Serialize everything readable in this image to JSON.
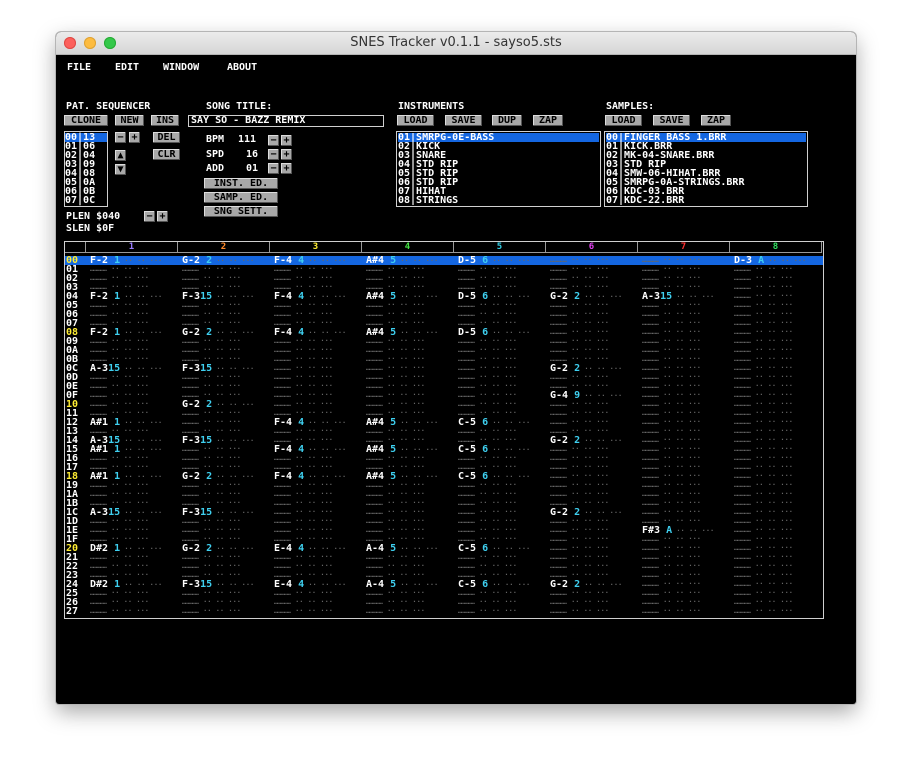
{
  "window": {
    "title": "SNES Tracker v0.1.1 - sayso5.sts"
  },
  "menu": [
    "FILE",
    "EDIT",
    "WINDOW",
    "ABOUT"
  ],
  "pattern_sequencer": {
    "heading": "PAT. SEQUENCER",
    "buttons": [
      "CLONE",
      "NEW",
      "INS",
      "DEL",
      "CLR"
    ],
    "entries": [
      "00|13",
      "01|06",
      "02|04",
      "03|09",
      "04|08",
      "05|0A",
      "06|0B",
      "07|0C"
    ],
    "selected": 0,
    "plen_label": "PLEN $040",
    "slen_label": "SLEN $0F"
  },
  "song": {
    "heading": "SONG TITLE:",
    "title": "SAY SO - BAZZ REMIX",
    "bpm_label": "BPM",
    "bpm": "111",
    "spd_label": "SPD",
    "spd": "16",
    "add_label": "ADD",
    "add": "01",
    "editor_buttons": [
      "INST. ED.",
      "SAMP. ED.",
      "SNG SETT."
    ]
  },
  "instruments": {
    "heading": "INSTRUMENTS",
    "buttons": [
      "LOAD",
      "SAVE",
      "DUP",
      "ZAP"
    ],
    "items": [
      "01|SMRPG-0E-BASS",
      "02|KICK",
      "03|SNARE",
      "04|STD RIP",
      "05|STD RIP",
      "06|STD RIP",
      "07|HIHAT",
      "08|STRINGS"
    ],
    "selected": 0
  },
  "samples": {
    "heading": "SAMPLES:",
    "buttons": [
      "LOAD",
      "SAVE",
      "ZAP"
    ],
    "items": [
      "00|FINGER BASS 1.BRR",
      "01|KICK.BRR",
      "02|MK-04-SNARE.BRR",
      "03|STD RIP",
      "04|SMW-06-HIHAT.BRR",
      "05|SMRPG-0A-STRINGS.BRR",
      "06|KDC-03.BRR",
      "07|KDC-22.BRR"
    ],
    "selected": 0
  },
  "tracker": {
    "channels": [
      {
        "label": "1",
        "color": "#9b7dff"
      },
      {
        "label": "2",
        "color": "#ff8a2a"
      },
      {
        "label": "3",
        "color": "#ffee33"
      },
      {
        "label": "4",
        "color": "#44e044"
      },
      {
        "label": "5",
        "color": "#33d0e8"
      },
      {
        "label": "6",
        "color": "#e040f0"
      },
      {
        "label": "7",
        "color": "#ff3030"
      },
      {
        "label": "8",
        "color": "#30e060"
      }
    ],
    "rows": [
      "00",
      "01",
      "02",
      "03",
      "04",
      "05",
      "06",
      "07",
      "08",
      "09",
      "0A",
      "0B",
      "0C",
      "0D",
      "0E",
      "0F",
      "10",
      "11",
      "12",
      "13",
      "14",
      "15",
      "16",
      "17",
      "18",
      "19",
      "1A",
      "1B",
      "1C",
      "1D",
      "1E",
      "1F",
      "20",
      "21",
      "22",
      "23",
      "24",
      "25",
      "26",
      "27"
    ],
    "highlight_row_color": "#ffee33",
    "selected_row": 0,
    "notes": [
      {
        "row": 0,
        "ch": 0,
        "note": "F-2",
        "ins": "1"
      },
      {
        "row": 0,
        "ch": 1,
        "note": "G-2",
        "ins": "2"
      },
      {
        "row": 0,
        "ch": 2,
        "note": "F-4",
        "ins": "4"
      },
      {
        "row": 0,
        "ch": 3,
        "note": "A#4",
        "ins": "5"
      },
      {
        "row": 0,
        "ch": 4,
        "note": "D-5",
        "ins": "6"
      },
      {
        "row": 0,
        "ch": 7,
        "note": "D-3",
        "ins": "A"
      },
      {
        "row": 4,
        "ch": 0,
        "note": "F-2",
        "ins": "1"
      },
      {
        "row": 4,
        "ch": 1,
        "note": "F-3",
        "ins": "15"
      },
      {
        "row": 4,
        "ch": 2,
        "note": "F-4",
        "ins": "4"
      },
      {
        "row": 4,
        "ch": 3,
        "note": "A#4",
        "ins": "5"
      },
      {
        "row": 4,
        "ch": 4,
        "note": "D-5",
        "ins": "6"
      },
      {
        "row": 4,
        "ch": 5,
        "note": "G-2",
        "ins": "2"
      },
      {
        "row": 4,
        "ch": 6,
        "note": "A-3",
        "ins": "15"
      },
      {
        "row": 8,
        "ch": 0,
        "note": "F-2",
        "ins": "1"
      },
      {
        "row": 8,
        "ch": 1,
        "note": "G-2",
        "ins": "2"
      },
      {
        "row": 8,
        "ch": 2,
        "note": "F-4",
        "ins": "4"
      },
      {
        "row": 8,
        "ch": 3,
        "note": "A#4",
        "ins": "5"
      },
      {
        "row": 8,
        "ch": 4,
        "note": "D-5",
        "ins": "6"
      },
      {
        "row": 12,
        "ch": 0,
        "note": "A-3",
        "ins": "15"
      },
      {
        "row": 12,
        "ch": 1,
        "note": "F-3",
        "ins": "15"
      },
      {
        "row": 12,
        "ch": 5,
        "note": "G-2",
        "ins": "2"
      },
      {
        "row": 15,
        "ch": 5,
        "note": "G-4",
        "ins": "9"
      },
      {
        "row": 16,
        "ch": 1,
        "note": "G-2",
        "ins": "2"
      },
      {
        "row": 18,
        "ch": 0,
        "note": "A#1",
        "ins": "1"
      },
      {
        "row": 18,
        "ch": 2,
        "note": "F-4",
        "ins": "4"
      },
      {
        "row": 18,
        "ch": 3,
        "note": "A#4",
        "ins": "5"
      },
      {
        "row": 18,
        "ch": 4,
        "note": "C-5",
        "ins": "6"
      },
      {
        "row": 20,
        "ch": 0,
        "note": "A-3",
        "ins": "15"
      },
      {
        "row": 20,
        "ch": 1,
        "note": "F-3",
        "ins": "15"
      },
      {
        "row": 20,
        "ch": 5,
        "note": "G-2",
        "ins": "2"
      },
      {
        "row": 21,
        "ch": 0,
        "note": "A#1",
        "ins": "1"
      },
      {
        "row": 21,
        "ch": 2,
        "note": "F-4",
        "ins": "4"
      },
      {
        "row": 21,
        "ch": 3,
        "note": "A#4",
        "ins": "5"
      },
      {
        "row": 21,
        "ch": 4,
        "note": "C-5",
        "ins": "6"
      },
      {
        "row": 24,
        "ch": 0,
        "note": "A#1",
        "ins": "1"
      },
      {
        "row": 24,
        "ch": 1,
        "note": "G-2",
        "ins": "2"
      },
      {
        "row": 24,
        "ch": 2,
        "note": "F-4",
        "ins": "4"
      },
      {
        "row": 24,
        "ch": 3,
        "note": "A#4",
        "ins": "5"
      },
      {
        "row": 24,
        "ch": 4,
        "note": "C-5",
        "ins": "6"
      },
      {
        "row": 28,
        "ch": 0,
        "note": "A-3",
        "ins": "15"
      },
      {
        "row": 28,
        "ch": 1,
        "note": "F-3",
        "ins": "15"
      },
      {
        "row": 28,
        "ch": 5,
        "note": "G-2",
        "ins": "2"
      },
      {
        "row": 30,
        "ch": 6,
        "note": "F#3",
        "ins": "A"
      },
      {
        "row": 32,
        "ch": 0,
        "note": "D#2",
        "ins": "1"
      },
      {
        "row": 32,
        "ch": 1,
        "note": "G-2",
        "ins": "2"
      },
      {
        "row": 32,
        "ch": 2,
        "note": "E-4",
        "ins": "4"
      },
      {
        "row": 32,
        "ch": 3,
        "note": "A-4",
        "ins": "5"
      },
      {
        "row": 32,
        "ch": 4,
        "note": "C-5",
        "ins": "6"
      },
      {
        "row": 36,
        "ch": 0,
        "note": "D#2",
        "ins": "1"
      },
      {
        "row": 36,
        "ch": 1,
        "note": "F-3",
        "ins": "15"
      },
      {
        "row": 36,
        "ch": 2,
        "note": "E-4",
        "ins": "4"
      },
      {
        "row": 36,
        "ch": 3,
        "note": "A-4",
        "ins": "5"
      },
      {
        "row": 36,
        "ch": 4,
        "note": "C-5",
        "ins": "6"
      },
      {
        "row": 36,
        "ch": 5,
        "note": "G-2",
        "ins": "2"
      }
    ]
  }
}
